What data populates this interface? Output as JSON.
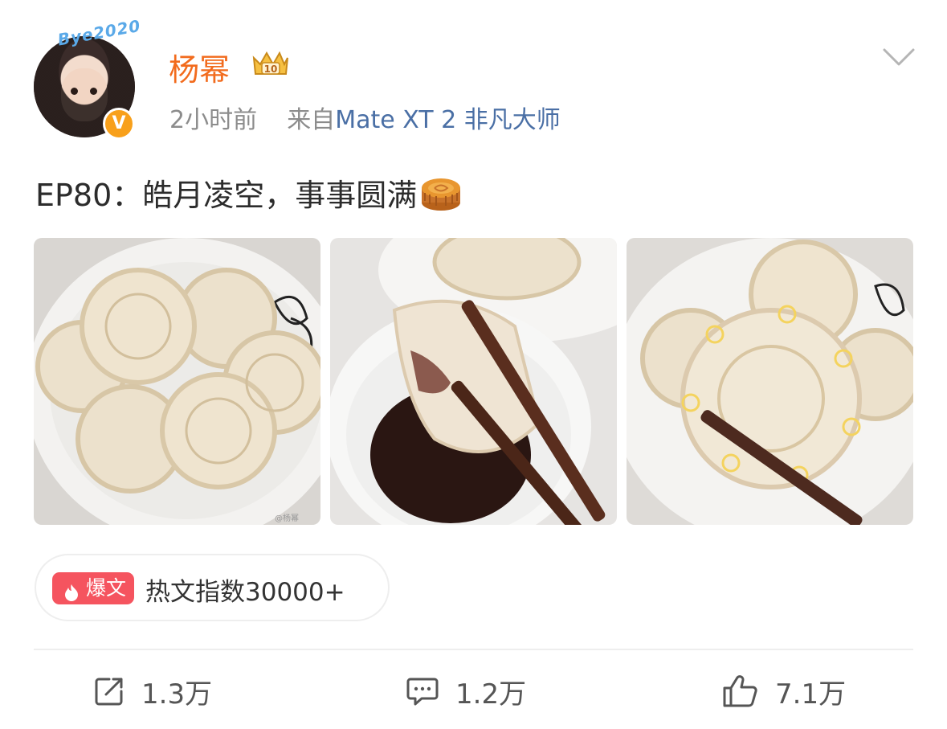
{
  "post": {
    "author": {
      "name": "杨幂",
      "avatar_sticker_text": "Bye2020",
      "verified_icon": "verified-v-badge",
      "vip_icon": "crown-vip-10-badge",
      "vip_level": "10"
    },
    "time": "2小时前",
    "source_prefix": "来自",
    "source": "Mate XT 2 非凡大师",
    "text": "EP80：皓月凌空，事事圆满",
    "text_emoji": "mooncake-emoji",
    "images": [
      {
        "alt": "mooncake-shaped dumplings on plate"
      },
      {
        "alt": "dumpling held with chopsticks over soy sauce"
      },
      {
        "alt": "dumpling with fu character held by chopsticks"
      }
    ],
    "image_watermark": "@杨幂"
  },
  "hot": {
    "tag": "爆文",
    "text": "热文指数30000+"
  },
  "actions": {
    "repost": {
      "icon": "share-icon",
      "count": "1.3万"
    },
    "comment": {
      "icon": "comment-icon",
      "count": "1.2万"
    },
    "like": {
      "icon": "thumbs-up-icon",
      "count": "7.1万"
    }
  },
  "colors": {
    "username": "#f26b1d",
    "source": "#4a6fa5",
    "meta": "#8c8c8c",
    "hot_tag": "#f5545f",
    "verified": "#f8a01b"
  }
}
